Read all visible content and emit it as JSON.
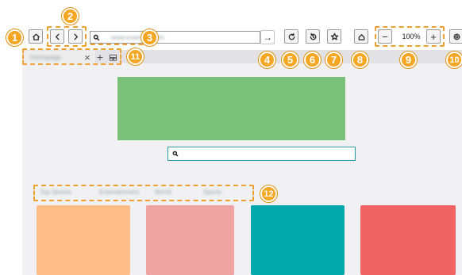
{
  "toolbar": {
    "address_placeholder": "www.example.com",
    "go_arrow": "→",
    "zoom_minus": "−",
    "zoom_level": "100%",
    "zoom_plus": "+"
  },
  "tabs": [
    {
      "label": "Homepage"
    }
  ],
  "tab_close": "×",
  "new_tab": "+",
  "bookmarks": [
    "Top Stories",
    "Entertainment",
    "World",
    "Sports"
  ],
  "annotations": [
    "1",
    "2",
    "3",
    "4",
    "5",
    "6",
    "7",
    "8",
    "9",
    "10",
    "11",
    "12"
  ],
  "colors": {
    "banner": "#7abf7a",
    "tile1": "#ffbd87",
    "tile2": "#f0a3a3",
    "tile3": "#00a7ab",
    "tile4": "#f06464",
    "annotation": "#f5a623"
  }
}
